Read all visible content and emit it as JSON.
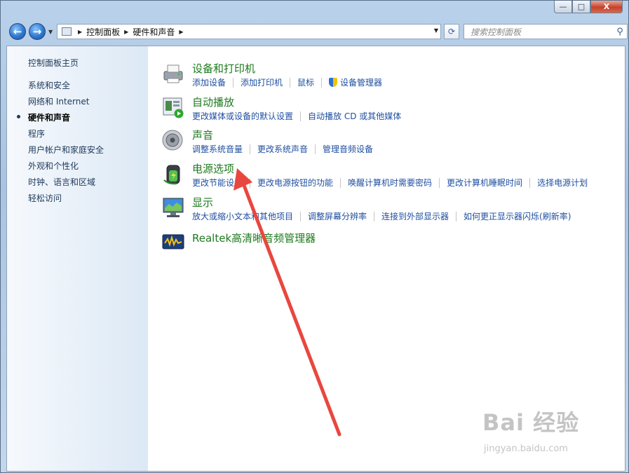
{
  "window": {
    "caption_buttons": {
      "minimize": "—",
      "maximize": "□",
      "close": "X"
    }
  },
  "nav": {
    "back_icon": "back-arrow-icon",
    "forward_icon": "forward-arrow-icon",
    "breadcrumb": [
      "控制面板",
      "硬件和声音"
    ],
    "search_placeholder": "搜索控制面板"
  },
  "sidebar": {
    "items": [
      {
        "label": "控制面板主页"
      },
      {
        "label": "系统和安全"
      },
      {
        "label": "网络和 Internet"
      },
      {
        "label": "硬件和声音",
        "active": true
      },
      {
        "label": "程序"
      },
      {
        "label": "用户帐户和家庭安全"
      },
      {
        "label": "外观和个性化"
      },
      {
        "label": "时钟、语言和区域"
      },
      {
        "label": "轻松访问"
      }
    ]
  },
  "categories": [
    {
      "title": "设备和打印机",
      "icon": "printer-icon",
      "links": [
        "添加设备",
        "添加打印机",
        "鼠标",
        "设备管理器"
      ]
    },
    {
      "title": "自动播放",
      "icon": "autoplay-icon",
      "links": [
        "更改媒体或设备的默认设置",
        "自动播放 CD 或其他媒体"
      ]
    },
    {
      "title": "声音",
      "icon": "speaker-icon",
      "links": [
        "调整系统音量",
        "更改系统声音",
        "管理音频设备"
      ]
    },
    {
      "title": "电源选项",
      "icon": "battery-icon",
      "links": [
        "更改节能设置",
        "更改电源按钮的功能",
        "唤醒计算机时需要密码",
        "更改计算机睡眠时间",
        "选择电源计划"
      ]
    },
    {
      "title": "显示",
      "icon": "monitor-icon",
      "links": [
        "放大或缩小文本和其他项目",
        "调整屏幕分辨率",
        "连接到外部显示器",
        "如何更正显示器闪烁(刷新率)"
      ]
    },
    {
      "title": "Realtek高清晰音频管理器",
      "icon": "realtek-audio-icon",
      "links": []
    }
  ],
  "watermark": {
    "logo": "Bai 经验",
    "url": "jingyan.baidu.com"
  },
  "colors": {
    "link": "#1f4fa0",
    "category_title": "#1e7a1e",
    "annotation_arrow": "#e8473f"
  }
}
